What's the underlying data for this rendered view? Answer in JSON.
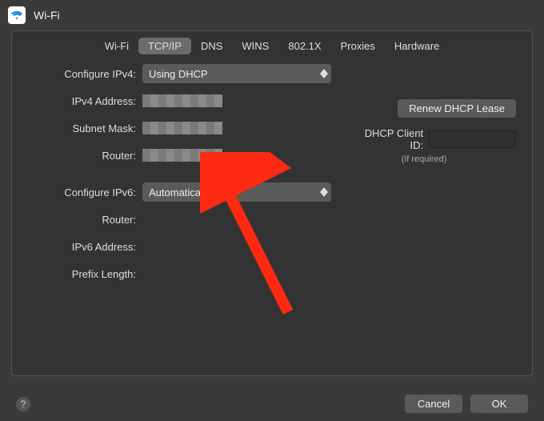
{
  "title": "Wi-Fi",
  "tabs": [
    "Wi-Fi",
    "TCP/IP",
    "DNS",
    "WINS",
    "802.1X",
    "Proxies",
    "Hardware"
  ],
  "selected_tab_index": 1,
  "labels": {
    "configure_ipv4": "Configure IPv4:",
    "ipv4_address": "IPv4 Address:",
    "subnet_mask": "Subnet Mask:",
    "router": "Router:",
    "configure_ipv6": "Configure IPv6:",
    "router6": "Router:",
    "ipv6_address": "IPv6 Address:",
    "prefix_length": "Prefix Length:",
    "dhcp_client_id": "DHCP Client ID:",
    "if_required": "(If required)"
  },
  "values": {
    "configure_ipv4": "Using DHCP",
    "configure_ipv6": "Automatically",
    "ipv4_address": "",
    "subnet_mask": "",
    "router": "",
    "router6": "",
    "ipv6_address": "",
    "prefix_length": "",
    "dhcp_client_id": ""
  },
  "buttons": {
    "renew": "Renew DHCP Lease",
    "cancel": "Cancel",
    "ok": "OK"
  }
}
